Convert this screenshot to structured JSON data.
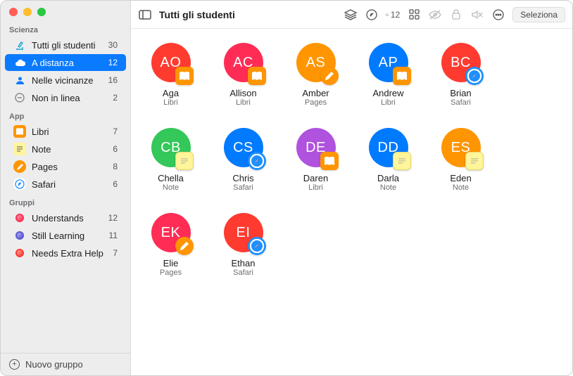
{
  "toolbar": {
    "title": "Tutti gli studenti",
    "inbox_count": "12",
    "select_label": "Seleziona"
  },
  "sidebar": {
    "sections": [
      {
        "title": "Scienza",
        "items": [
          {
            "icon": "microscope",
            "iconColor": "#2aaad5",
            "iconBg": "",
            "label": "Tutti gli studenti",
            "count": "30"
          },
          {
            "icon": "cloud",
            "iconColor": "#fff",
            "iconBg": "",
            "label": "A distanza",
            "count": "12",
            "selected": true
          },
          {
            "icon": "person",
            "iconColor": "#0a7aff",
            "iconBg": "",
            "label": "Nelle vicinanze",
            "count": "16"
          },
          {
            "icon": "minus-circle",
            "iconColor": "#8e8e93",
            "iconBg": "",
            "label": "Non in linea",
            "count": "2"
          }
        ]
      },
      {
        "title": "App",
        "items": [
          {
            "icon": "book",
            "iconColor": "#fff",
            "iconBg": "#ff9500",
            "label": "Libri",
            "count": "7"
          },
          {
            "icon": "note",
            "iconColor": "#555",
            "iconBg": "#fff59a",
            "label": "Note",
            "count": "6"
          },
          {
            "icon": "pen",
            "iconColor": "#fff",
            "iconBg": "#ff9500",
            "round": true,
            "label": "Pages",
            "count": "8"
          },
          {
            "icon": "compass",
            "iconColor": "#1e90ff",
            "iconBg": "#fff",
            "round": true,
            "label": "Safari",
            "count": "6"
          }
        ]
      },
      {
        "title": "Gruppi",
        "items": [
          {
            "icon": "group-dot",
            "iconColor": "#ff2d55",
            "label": "Understands",
            "count": "12"
          },
          {
            "icon": "group-dot",
            "iconColor": "#5856d6",
            "label": "Still Learning",
            "count": "11"
          },
          {
            "icon": "group-dot",
            "iconColor": "#ff3b30",
            "label": "Needs Extra Help",
            "count": "7"
          }
        ]
      }
    ],
    "footer_label": "Nuovo gruppo"
  },
  "students": [
    {
      "initials": "AO",
      "color": "#ff3b30",
      "name": "Aga",
      "app": "Libri",
      "badge": "libri"
    },
    {
      "initials": "AC",
      "color": "#ff2d55",
      "name": "Allison",
      "app": "Libri",
      "badge": "libri"
    },
    {
      "initials": "AS",
      "color": "#ff9500",
      "name": "Amber",
      "app": "Pages",
      "badge": "pages"
    },
    {
      "initials": "AP",
      "color": "#007aff",
      "name": "Andrew",
      "app": "Libri",
      "badge": "libri"
    },
    {
      "initials": "BC",
      "color": "#ff3b30",
      "name": "Brian",
      "app": "Safari",
      "badge": "safari"
    },
    {
      "initials": "CB",
      "color": "#34c759",
      "name": "Chella",
      "app": "Note",
      "badge": "note"
    },
    {
      "initials": "CS",
      "color": "#007aff",
      "name": "Chris",
      "app": "Safari",
      "badge": "safari"
    },
    {
      "initials": "DE",
      "color": "#af52de",
      "name": "Daren",
      "app": "Libri",
      "badge": "libri"
    },
    {
      "initials": "DD",
      "color": "#007aff",
      "name": "Darla",
      "app": "Note",
      "badge": "note"
    },
    {
      "initials": "ES",
      "color": "#ff9500",
      "name": "Eden",
      "app": "Note",
      "badge": "note"
    },
    {
      "initials": "EK",
      "color": "#ff2d55",
      "name": "Elie",
      "app": "Pages",
      "badge": "pages"
    },
    {
      "initials": "EI",
      "color": "#ff3b30",
      "name": "Ethan",
      "app": "Safari",
      "badge": "safari"
    }
  ]
}
